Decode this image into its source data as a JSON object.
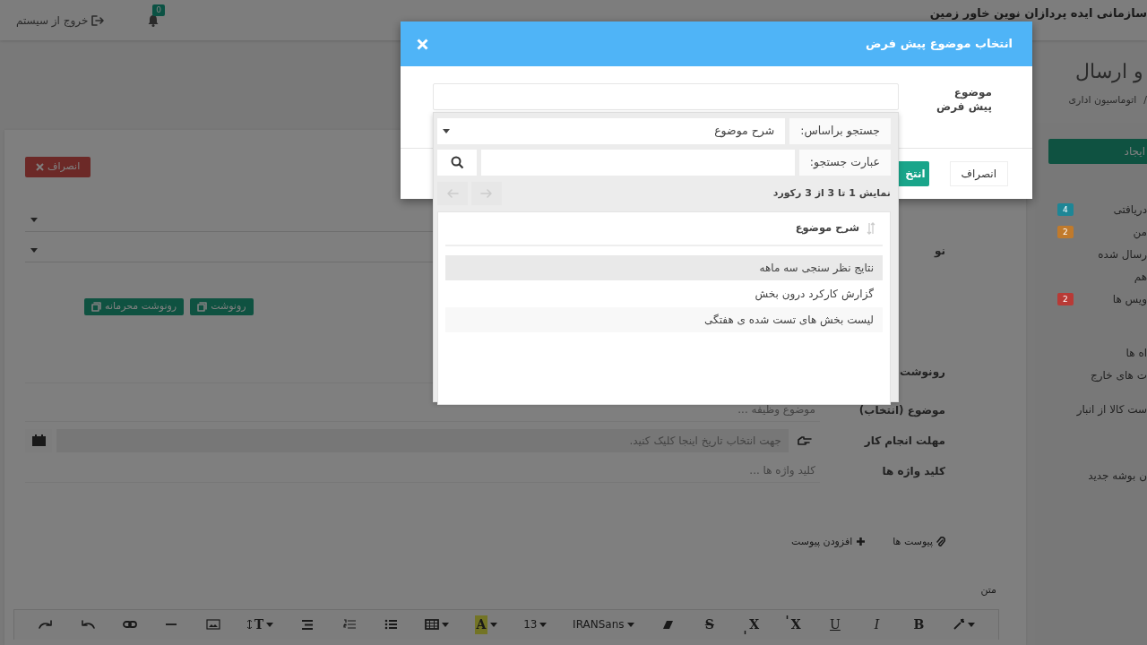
{
  "header": {
    "org_name": "سازمانی ایده پردازان نوین خاور زمین",
    "notification_count": "0",
    "logout": "خروج از سیستم"
  },
  "page": {
    "title": "و ارسال",
    "breadcrumb_separator": "/",
    "breadcrumb": "اتوماسیون اداری"
  },
  "sidebar": {
    "create_button": "ایجاد",
    "items": [
      {
        "label": "دریافتی",
        "badge": "4",
        "color": "#1e8696"
      },
      {
        "label": "من",
        "badge": "2",
        "color": "#c07a2c"
      },
      {
        "label": "رسال شده"
      },
      {
        "label": "هم"
      },
      {
        "label": "ویس ها",
        "badge": "2",
        "color": "#b83a36"
      },
      {
        "label": "اه ها"
      },
      {
        "label": "ت های خارج"
      },
      {
        "label": "ست کالا از انبار"
      },
      {
        "label": "ن بوشه جدید"
      }
    ]
  },
  "form": {
    "cancel_button": "انصراف",
    "rows": [
      {
        "kind": "select"
      },
      {
        "kind": "select",
        "label": "نو"
      },
      {
        "kind": "cc_buttons",
        "buttons": [
          "رونوشت",
          "رونوشت محرمانه"
        ]
      },
      {
        "kind": "text",
        "label": "رونوشت"
      },
      {
        "kind": "text",
        "label": "موضوع (انتخاب)",
        "placeholder": "موضوع وظیفه ..."
      },
      {
        "kind": "date",
        "label": "مهلت انجام کار",
        "placeholder": "جهت انتخاب تاریخ اینجا کلیک کنید."
      },
      {
        "kind": "text",
        "label": "کلید واژه ها",
        "placeholder": "کلید واژه ها ..."
      }
    ],
    "attachments": {
      "label": "پیوست ها",
      "add_button": "افزودن پیوست"
    },
    "body_label": "متن",
    "toolbar": [
      {
        "kind": "wand",
        "caret": true
      },
      {
        "kind": "bold",
        "label": "B"
      },
      {
        "kind": "italic",
        "label": "I"
      },
      {
        "kind": "underline",
        "label": "U"
      },
      {
        "kind": "superscript",
        "label": "X"
      },
      {
        "kind": "subscript",
        "label": "X"
      },
      {
        "kind": "strike",
        "label": "S"
      },
      {
        "kind": "eraser"
      },
      {
        "kind": "font",
        "value": "IRANSans",
        "caret": true
      },
      {
        "kind": "size",
        "value": "13",
        "caret": true
      },
      {
        "kind": "highlight",
        "label": "A",
        "caret": true
      },
      {
        "kind": "table",
        "caret": true
      },
      {
        "kind": "ul"
      },
      {
        "kind": "ol"
      },
      {
        "kind": "align"
      },
      {
        "kind": "height",
        "label": "T",
        "caret": true
      },
      {
        "kind": "image"
      },
      {
        "kind": "hr"
      },
      {
        "kind": "link"
      },
      {
        "kind": "undo"
      },
      {
        "kind": "redo"
      }
    ]
  },
  "modal": {
    "title": "انتخاب موضوع پیش فرض",
    "field_label": "موضوع پیش فرض",
    "buttons": [
      {
        "kind": "secondary",
        "label": "انصراف"
      },
      {
        "kind": "primary",
        "label": "انتخ"
      }
    ],
    "picker": {
      "search_by_label": "جستجو براساس:",
      "search_by_value": "شرح موضوع",
      "search_term_label": "عبارت جستجو:",
      "record_info": "نمایش 1 تا 3 از 3 رکورد",
      "next_disabled": true,
      "prev_disabled": true,
      "column": "شرح موضوع",
      "rows": [
        {
          "text": "نتایج نظر سنجی سه ماهه",
          "selected": true
        },
        {
          "text": "گزارش کارکرد درون بخش",
          "selected": false
        },
        {
          "text": "لیست بخش های تست شده ی هفتگی",
          "selected": false
        }
      ]
    }
  }
}
